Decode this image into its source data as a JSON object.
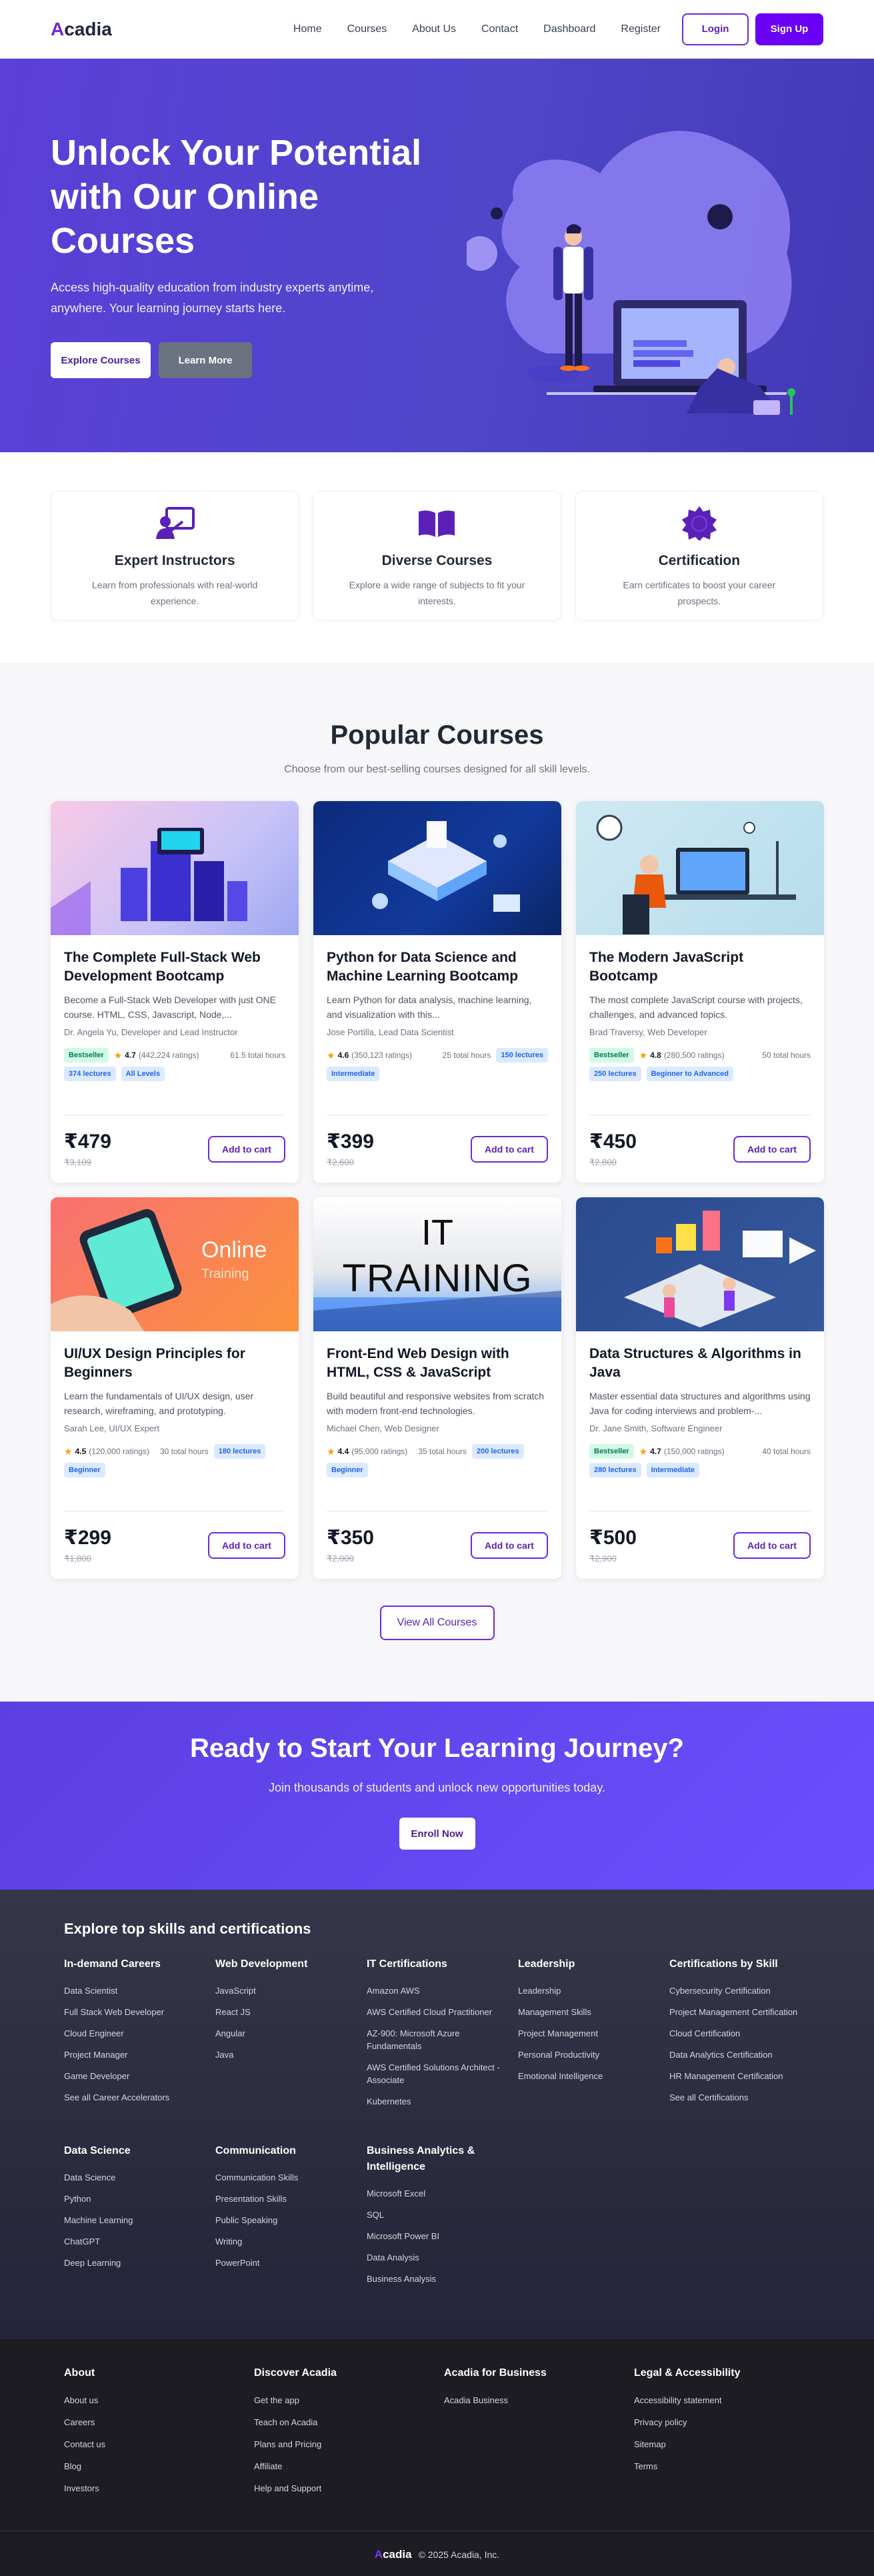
{
  "nav": {
    "logo_first": "A",
    "logo_rest": "cadia",
    "links": [
      "Home",
      "Courses",
      "About Us",
      "Contact",
      "Dashboard",
      "Register"
    ],
    "login": "Login",
    "signup": "Sign Up"
  },
  "hero": {
    "title": "Unlock Your Potential with Our Online Courses",
    "subtitle": "Access high-quality education from industry experts anytime, anywhere. Your learning journey starts here.",
    "btn_explore": "Explore Courses",
    "btn_more": "Learn More"
  },
  "features": [
    {
      "icon": "instructor-board-icon",
      "title": "Expert Instructors",
      "desc": "Learn from professionals with real-world experience."
    },
    {
      "icon": "open-book-icon",
      "title": "Diverse Courses",
      "desc": "Explore a wide range of subjects to fit your interests."
    },
    {
      "icon": "certificate-badge-icon",
      "title": "Certification",
      "desc": "Earn certificates to boost your career prospects."
    }
  ],
  "popular": {
    "title": "Popular Courses",
    "subtitle": "Choose from our best-selling courses designed for all skill levels.",
    "view_all": "View All Courses",
    "add_to_cart": "Add to cart",
    "courses": [
      {
        "title": "The Complete Full-Stack Web Development Bootcamp",
        "desc": "Become a Full-Stack Web Developer with just ONE course. HTML, CSS, Javascript, Node,...",
        "instructor": "Dr. Angela Yu, Developer and Lead Instructor",
        "bestseller": "Bestseller",
        "rating": "4.7",
        "ratings": "(442,224 ratings)",
        "hours": "61.5 total hours",
        "lectures": "374 lectures",
        "level": "All Levels",
        "price": "₹479",
        "orig": "₹3,109"
      },
      {
        "title": "Python for Data Science and Machine Learning Bootcamp",
        "desc": "Learn Python for data analysis, machine learning, and visualization with this...",
        "instructor": "Jose Portilla, Lead Data Scientist",
        "rating": "4.6",
        "ratings": "(350,123 ratings)",
        "hours": "25 total hours",
        "lectures": "150 lectures",
        "level": "Intermediate",
        "price": "₹399",
        "orig": "₹2,600"
      },
      {
        "title": "The Modern JavaScript Bootcamp",
        "desc": "The most complete JavaScript course with projects, challenges, and advanced topics.",
        "instructor": "Brad Traversy, Web Developer",
        "bestseller": "Bestseller",
        "rating": "4.8",
        "ratings": "(280,500 ratings)",
        "hours": "50 total hours",
        "lectures": "250 lectures",
        "level": "Beginner to Advanced",
        "price": "₹450",
        "orig": "₹2,800"
      },
      {
        "title": "UI/UX Design Principles for Beginners",
        "desc": "Learn the fundamentals of UI/UX design, user research, wireframing, and prototyping.",
        "instructor": "Sarah Lee, UI/UX Expert",
        "rating": "4.5",
        "ratings": "(120,000 ratings)",
        "hours": "30 total hours",
        "lectures": "180 lectures",
        "level": "Beginner",
        "price": "₹299",
        "orig": "₹1,800",
        "img_text1": "Online",
        "img_text2": "Training"
      },
      {
        "title": "Front-End Web Design with HTML, CSS & JavaScript",
        "desc": "Build beautiful and responsive websites from scratch with modern front-end technologies.",
        "instructor": "Michael Chen, Web Designer",
        "rating": "4.4",
        "ratings": "(95,000 ratings)",
        "hours": "35 total hours",
        "lectures": "200 lectures",
        "level": "Beginner",
        "price": "₹350",
        "orig": "₹2,000",
        "img_text1": "IT",
        "img_text2": "TRAINING"
      },
      {
        "title": "Data Structures & Algorithms in Java",
        "desc": "Master essential data structures and algorithms using Java for coding interviews and problem-...",
        "instructor": "Dr. Jane Smith, Software Engineer",
        "bestseller": "Bestseller",
        "rating": "4.7",
        "ratings": "(150,000 ratings)",
        "hours": "40 total hours",
        "lectures": "280 lectures",
        "level": "Intermediate",
        "price": "₹500",
        "orig": "₹2,900"
      }
    ]
  },
  "cta": {
    "title": "Ready to Start Your Learning Journey?",
    "subtitle": "Join thousands of students and unlock new opportunities today.",
    "button": "Enroll Now"
  },
  "skills": {
    "title": "Explore top skills and certifications",
    "columns": [
      {
        "heading": "In-demand Careers",
        "items": [
          "Data Scientist",
          "Full Stack Web Developer",
          "Cloud Engineer",
          "Project Manager",
          "Game Developer",
          "See all Career Accelerators"
        ]
      },
      {
        "heading": "Web Development",
        "items": [
          "JavaScript",
          "React JS",
          "Angular",
          "Java"
        ]
      },
      {
        "heading": "IT Certifications",
        "items": [
          "Amazon AWS",
          "AWS Certified Cloud Practitioner",
          "AZ-900: Microsoft Azure Fundamentals",
          "AWS Certified Solutions Architect - Associate",
          "Kubernetes"
        ]
      },
      {
        "heading": "Leadership",
        "items": [
          "Leadership",
          "Management Skills",
          "Project Management",
          "Personal Productivity",
          "Emotional Intelligence"
        ]
      },
      {
        "heading": "Certifications by Skill",
        "items": [
          "Cybersecurity Certification",
          "Project Management Certification",
          "Cloud Certification",
          "Data Analytics Certification",
          "HR Management Certification",
          "See all Certifications"
        ]
      },
      {
        "heading": "Data Science",
        "items": [
          "Data Science",
          "Python",
          "Machine Learning",
          "ChatGPT",
          "Deep Learning"
        ]
      },
      {
        "heading": "Communication",
        "items": [
          "Communication Skills",
          "Presentation Skills",
          "Public Speaking",
          "Writing",
          "PowerPoint"
        ]
      },
      {
        "heading": "Business Analytics & Intelligence",
        "items": [
          "Microsoft Excel",
          "SQL",
          "Microsoft Power BI",
          "Data Analysis",
          "Business Analysis"
        ]
      }
    ]
  },
  "footer": {
    "columns": [
      {
        "heading": "About",
        "items": [
          "About us",
          "Careers",
          "Contact us",
          "Blog",
          "Investors"
        ]
      },
      {
        "heading": "Discover Acadia",
        "items": [
          "Get the app",
          "Teach on Acadia",
          "Plans and Pricing",
          "Affiliate",
          "Help and Support"
        ]
      },
      {
        "heading": "Acadia for Business",
        "items": [
          "Acadia Business"
        ]
      },
      {
        "heading": "Legal & Accessibility",
        "items": [
          "Accessibility statement",
          "Privacy policy",
          "Sitemap",
          "Terms"
        ]
      }
    ],
    "copyright": "© 2025 Acadia, Inc."
  }
}
